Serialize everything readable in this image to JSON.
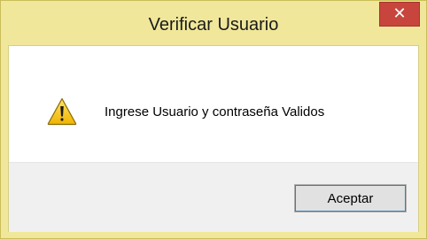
{
  "window": {
    "title": "Verificar Usuario"
  },
  "close_button": {
    "icon": "close-icon",
    "glyph": "✕",
    "color": "#c7453d"
  },
  "message": {
    "icon": "warning-icon",
    "text": "Ingrese Usuario y contraseña Validos"
  },
  "buttons": {
    "ok_label": "Aceptar"
  },
  "colors": {
    "title_bar": "#f0e79a",
    "content_bg": "#ffffff",
    "button_area_bg": "#f0f0f0",
    "warning_yellow": "#f5c518"
  }
}
